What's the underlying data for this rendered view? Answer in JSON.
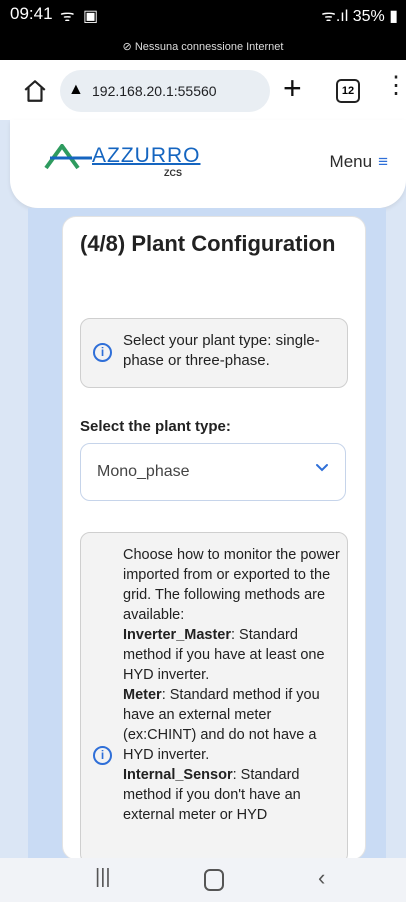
{
  "status": {
    "time": "09:41",
    "battery": "35%",
    "network_notice": "Nessuna connessione Internet"
  },
  "browser": {
    "url": "192.168.20.1:55560",
    "tab_count": "12"
  },
  "header": {
    "logo_text": "AZZURRO",
    "logo_sub": "ZCS",
    "menu_label": "Menu"
  },
  "page": {
    "title": "(4/8) Plant Configuration",
    "info_plant_type": "Select your plant type: single-phase or three-phase.",
    "select_label": "Select the plant type:",
    "select_value": "Mono_phase",
    "monitor_intro": "Choose how to monitor the power imported from or exported to the grid. The following methods are available:",
    "method1_name": "Inverter_Master",
    "method1_desc": ": Standard method if you have at least one HYD inverter.",
    "method2_name": "Meter",
    "method2_desc": ": Standard method if you have an external meter (ex:CHINT) and do not have a HYD inverter.",
    "method3_name": "Internal_Sensor",
    "method3_desc": ": Standard method if you don't have an external meter or HYD"
  },
  "colors": {
    "accent": "#2f6fd8",
    "page_bg": "#dbe6f5",
    "card_bg": "#ffffff",
    "info_bg": "#f3f3f3"
  }
}
